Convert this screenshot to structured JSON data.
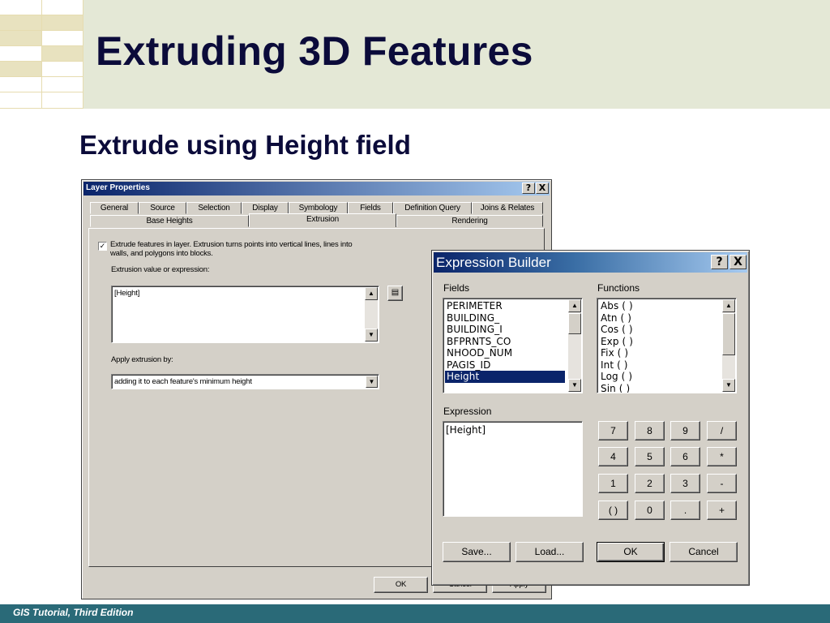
{
  "slide": {
    "title": "Extruding 3D Features",
    "subtitle": "Extrude using Height field",
    "footer": "GIS Tutorial, Third Edition"
  },
  "layer_properties": {
    "title": "Layer Properties",
    "help_btn": "?",
    "close_btn": "X",
    "tabs_row1": [
      "General",
      "Source",
      "Selection",
      "Display",
      "Symbology",
      "Fields",
      "Definition Query",
      "Joins & Relates"
    ],
    "tabs_row2": [
      "Base Heights",
      "Extrusion",
      "Rendering"
    ],
    "active_tab": "Extrusion",
    "extrude_checked": true,
    "extrude_label": "Extrude features in layer.  Extrusion turns points into vertical lines, lines into",
    "extrude_label_2": "walls, and polygons into blocks.",
    "extrusion_value_label": "Extrusion value or expression:",
    "extrusion_value": "[Height]",
    "apply_label": "Apply extrusion by:",
    "apply_value": "adding it to each feature's minimum height",
    "buttons": {
      "ok": "OK",
      "cancel": "Cancel",
      "apply": "Apply"
    }
  },
  "expression_builder": {
    "title": "Expression Builder",
    "help_btn": "?",
    "close_btn": "X",
    "fields_label": "Fields",
    "fields": [
      "PERIMETER",
      "BUILDING_",
      "BUILDING_I",
      "BFPRNTS_CO",
      "NHOOD_NUM",
      "PAGIS_ID",
      "Height"
    ],
    "selected_field": "Height",
    "functions_label": "Functions",
    "functions": [
      "Abs ( )",
      "Atn ( )",
      "Cos ( )",
      "Exp ( )",
      "Fix ( )",
      "Int ( )",
      "Log ( )",
      "Sin ( )"
    ],
    "expression_label": "Expression",
    "expression": "[Height]",
    "keypad": [
      [
        "7",
        "8",
        "9",
        "/"
      ],
      [
        "4",
        "5",
        "6",
        "*"
      ],
      [
        "1",
        "2",
        "3",
        "-"
      ],
      [
        "( )",
        "0",
        ".",
        "+"
      ]
    ],
    "buttons": {
      "save": "Save...",
      "load": "Load...",
      "ok": "OK",
      "cancel": "Cancel"
    }
  }
}
